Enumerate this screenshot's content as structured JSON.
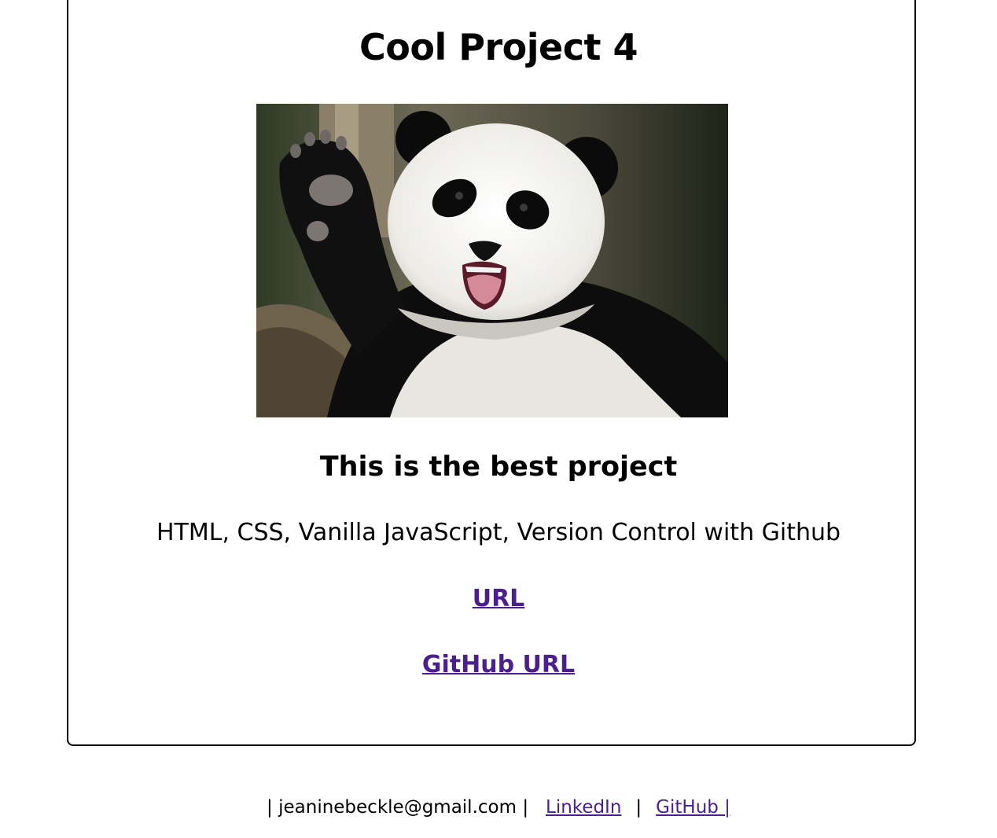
{
  "project": {
    "title": "Cool Project 4",
    "subtitle": "This is the best project",
    "technologies": "HTML, CSS, Vanilla JavaScript, Version Control with Github",
    "url_label": "URL",
    "github_url_label": "GitHub URL"
  },
  "footer": {
    "email_text": "| jeaninebeckle@gmail.com |",
    "separator": "|",
    "linkedin_label": "LinkedIn",
    "github_label": "GitHub |"
  },
  "colors": {
    "link": "#4b1f8e",
    "text": "#000000",
    "border": "#000000",
    "background": "#ffffff"
  }
}
